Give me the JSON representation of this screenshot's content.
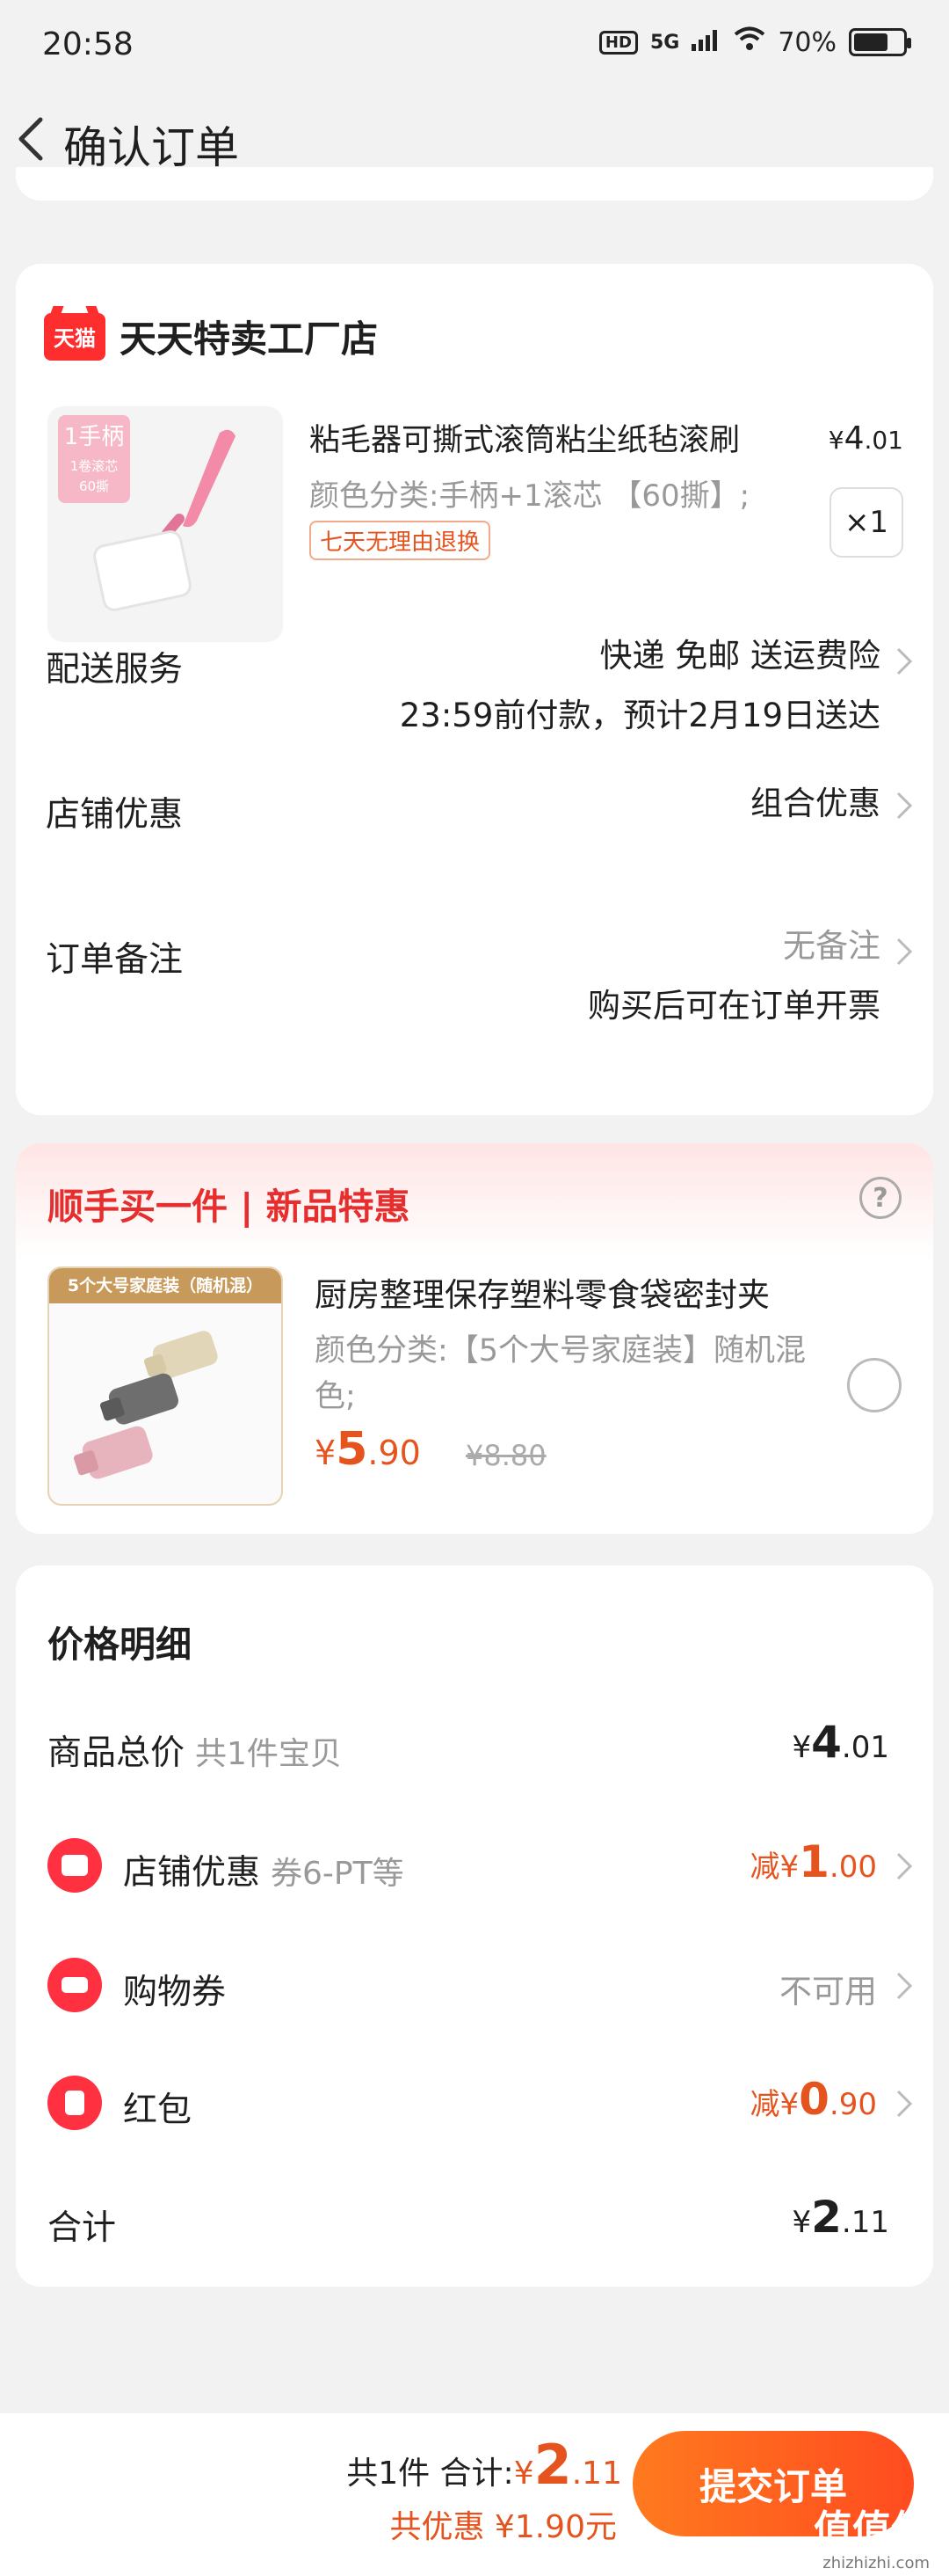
{
  "status_bar": {
    "time": "20:58",
    "hd": "HD",
    "network": "5G",
    "battery": "70%",
    "battery_level": 0.7
  },
  "nav": {
    "title": "确认订单"
  },
  "store": {
    "name": "天天特卖工厂店",
    "logo_text": "天猫",
    "product": {
      "title": "粘毛器可撕式滚筒粘尘纸毡滚刷",
      "price_symbol": "¥",
      "price_int": "4",
      "price_dec": ".01",
      "sku": "颜色分类:手柄+1滚芯 【60撕】;",
      "return_badge": "七天无理由退换",
      "quantity": "×1",
      "thumb_tag": {
        "line1": "1手柄",
        "line2": "1卷滚芯",
        "line3": "60撕"
      }
    },
    "rows": [
      {
        "label": "配送服务",
        "line1": "快递 免邮 送运费险",
        "line2": "23:59前付款，预计2月19日送达"
      },
      {
        "label": "店铺优惠",
        "line1": "组合优惠"
      },
      {
        "label": "订单备注",
        "line1": "无备注",
        "line2": "购买后可在订单开票"
      }
    ]
  },
  "addon": {
    "title": "顺手买一件 | 新品特惠",
    "help": "?",
    "thumb_banner": "5个大号家庭装（随机混）",
    "name": "厨房整理保存塑料零食袋密封夹",
    "sku": "颜色分类:【5个大号家庭装】随机混色;",
    "price_symbol": "¥",
    "price_int": "5",
    "price_dec": ".90",
    "orig_price": "¥8.80"
  },
  "price_detail": {
    "title": "价格明细",
    "goods_total": {
      "label": "商品总价",
      "sub": "共1件宝贝",
      "symbol": "¥",
      "int": "4",
      "dec": ".01"
    },
    "store_discount": {
      "label": "店铺优惠",
      "sub": "券6-PT等",
      "prefix": "减",
      "symbol": "¥",
      "int": "1",
      "dec": ".00"
    },
    "shopping_coupon": {
      "label": "购物券",
      "value": "不可用"
    },
    "red_packet": {
      "label": "红包",
      "prefix": "减",
      "symbol": "¥",
      "int": "0",
      "dec": ".90"
    },
    "total": {
      "label": "合计",
      "symbol": "¥",
      "int": "2",
      "dec": ".11"
    }
  },
  "bottom": {
    "count_text": "共1件",
    "total_label": "合计:",
    "symbol": "¥",
    "int": "2",
    "dec": ".11",
    "discount_text": "共优惠 ¥1.90元",
    "submit": "提交订单",
    "watermark_main": "值值值",
    "watermark_url": "zhizhizhi.com"
  },
  "colors": {
    "accent": "#e5541e",
    "brand_red": "#ff2e2e",
    "button": "#ff5a1f"
  }
}
